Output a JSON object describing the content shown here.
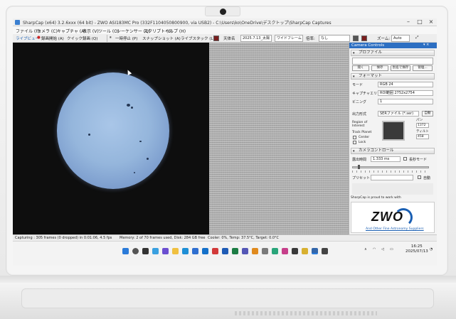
{
  "window": {
    "title": "SharpCap (x64) 3.2.6xxx (64 bit) - ZWO ASI183MC Pro (332F1104050800900, via USB2) - C:\\Users\\ko\\OneDrive\\デスクトップ\\SharpCap Captures"
  },
  "menu": {
    "items": [
      "ファイル (F)",
      "カメラ (C)",
      "キャプチャ (A)",
      "表示 (V)",
      "ツール (O)",
      "シーケンサー (Q)",
      "スクリプト (S)",
      "ヘルプ (H)"
    ]
  },
  "toolbar": {
    "live_view": "ライブビュー",
    "start_capture": "録画開始 (A)",
    "quick_capture": "クイック録画 (Q)",
    "pause": "一時停止 (P)",
    "snapshot": "スナップショット (A)",
    "live_stack": "ライブスタック (L)",
    "display": "天体名",
    "date_select": "2025.7.13_太陽",
    "frame_select": "ワイドフレーム",
    "scale_select": "なし",
    "zoom_label": "ズーム:",
    "zoom_value": "Auto",
    "swatch_color": "#7a1f1f"
  },
  "panel": {
    "title": "Camera Controls",
    "profile": {
      "header": "プロファイル",
      "buttons": [
        "開く",
        "保存",
        "別名で保存",
        "管理..."
      ]
    },
    "format": {
      "header": "フォーマット",
      "mode_label": "モード",
      "mode_value": "RGB 24",
      "capture_area_label": "キャプチャエリア",
      "capture_area_value": "ROI範囲 2752x2754",
      "binning_label": "ビニング",
      "binning_value": "1",
      "output_label": "出力形式",
      "output_value": "SERファイル (*.ser)",
      "output_btn": "自動",
      "roi_label": "Region of Interest",
      "track_label": "Track Planet",
      "center_label": "Center",
      "lock_label": "Lock",
      "pan_label": "パン",
      "pan_value": "1372",
      "tilt_label": "ティルト",
      "tilt_value": "458"
    },
    "camera_control": {
      "header": "カメラコントロール",
      "exposure_label": "露出時間",
      "exposure_value": "1.333 ms",
      "long_exposure_label": "長秒モード",
      "preset_label": "プリセット",
      "auto_label": "自動"
    },
    "zwo": {
      "caption": "SharpCap is proud to work with",
      "logo": "ZWO",
      "link": "And Other Fine Astronomy Suppliers"
    }
  },
  "status": {
    "capturing": "Capturing : 305 frames (0 dropped) in 0:01:06, 4.5 fps",
    "memory": "Memory: 2 of 70 frames used, Disk: 284 GB free",
    "cooler": "Cooler: 0%, Temp: 37.5°C, Target: 0.0°C"
  },
  "taskbar": {
    "time": "16:25",
    "date": "2025/07/13"
  }
}
